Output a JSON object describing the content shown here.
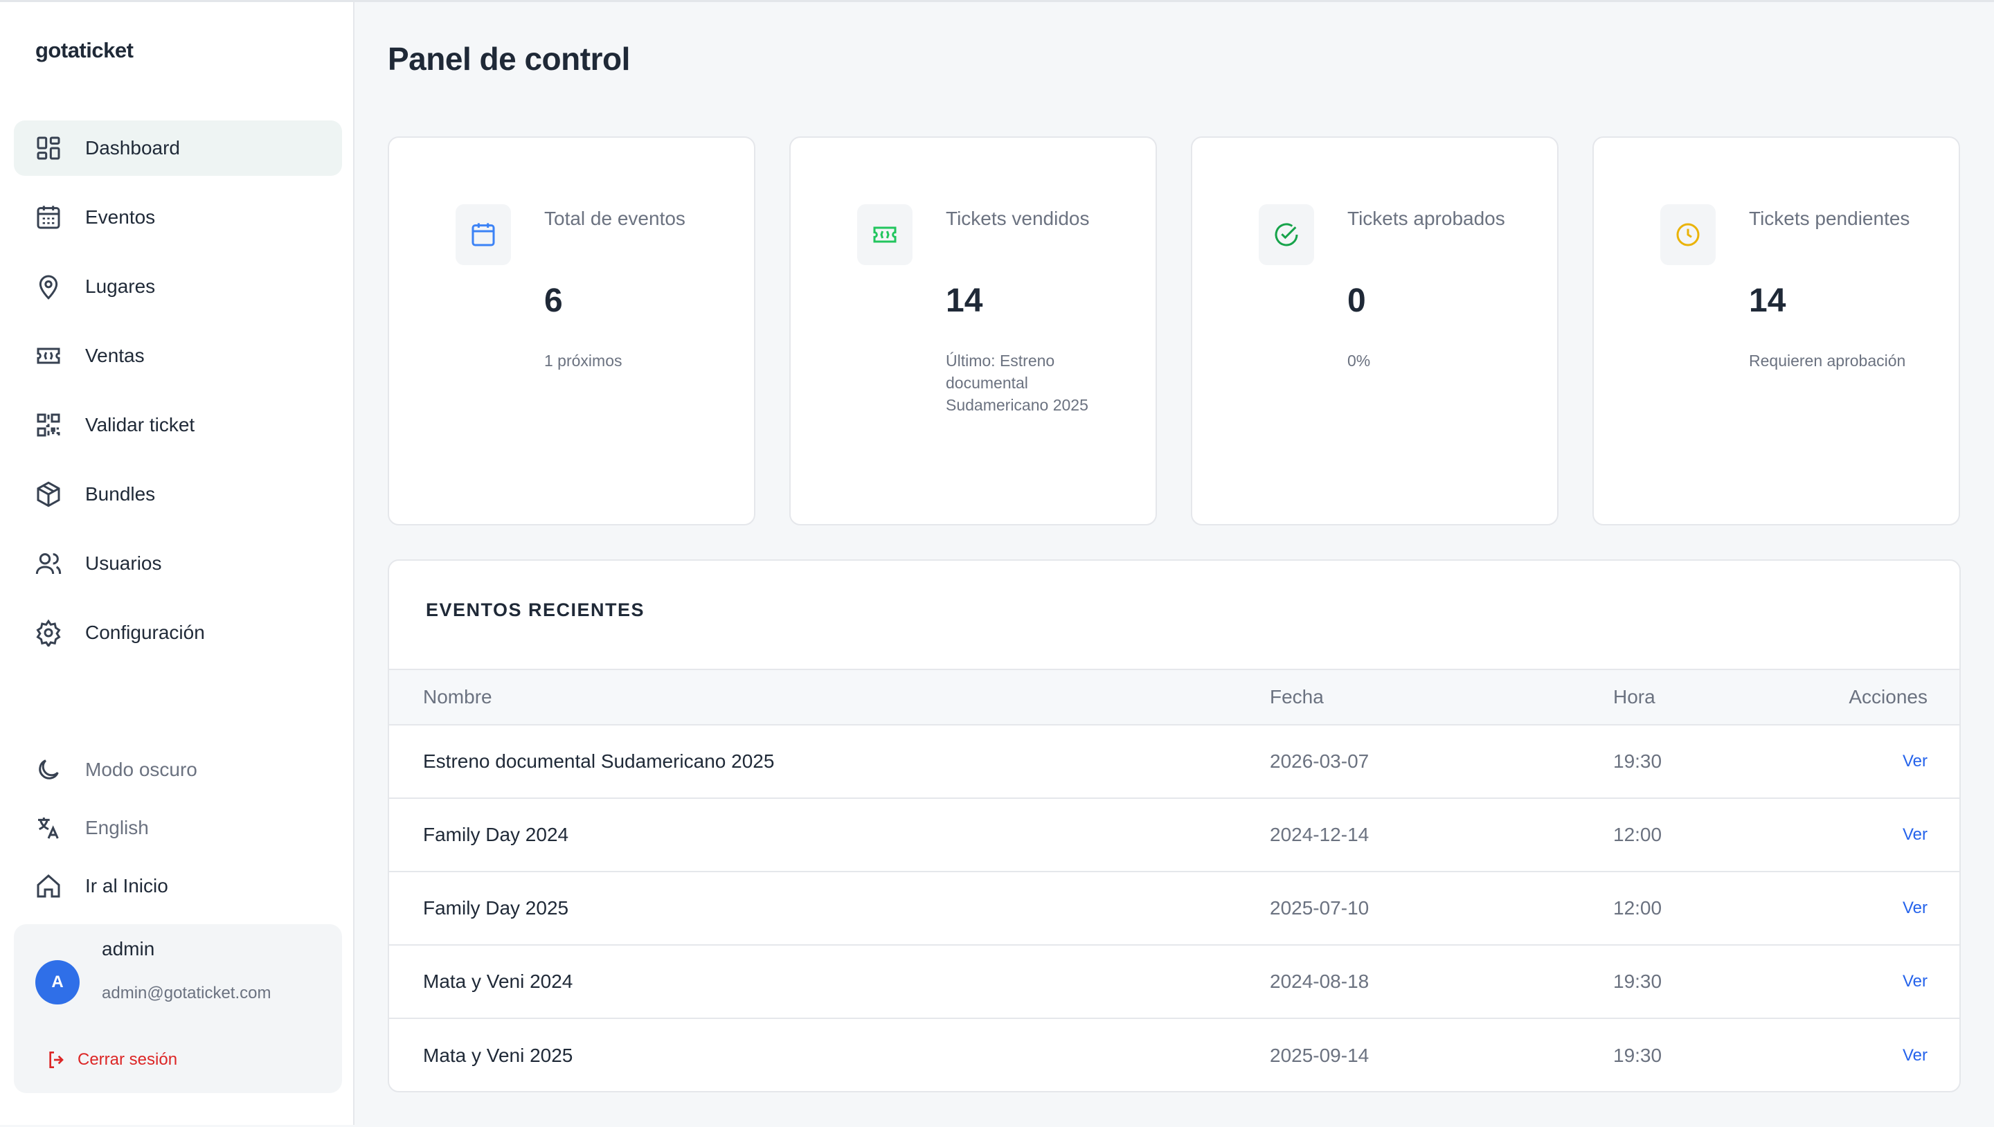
{
  "brand": "gotaticket",
  "nav": [
    {
      "label": "Dashboard",
      "icon": "dashboard-icon",
      "active": true
    },
    {
      "label": "Eventos",
      "icon": "calendar-icon"
    },
    {
      "label": "Lugares",
      "icon": "map-pin-icon"
    },
    {
      "label": "Ventas",
      "icon": "ticket-icon"
    },
    {
      "label": "Validar ticket",
      "icon": "qr-code-icon"
    },
    {
      "label": "Bundles",
      "icon": "package-icon"
    },
    {
      "label": "Usuarios",
      "icon": "users-icon"
    },
    {
      "label": "Configuración",
      "icon": "gear-icon"
    }
  ],
  "bottom": {
    "dark_mode": "Modo oscuro",
    "language": "English",
    "home": "Ir al Inicio"
  },
  "user": {
    "initial": "A",
    "name": "admin",
    "email": "admin@gotaticket.com",
    "logout": "Cerrar sesión"
  },
  "page_title": "Panel de control",
  "stats": [
    {
      "label": "Total de eventos",
      "value": "6",
      "sub": "1 próximos",
      "icon": "calendar-icon",
      "color": "#3b82f6"
    },
    {
      "label": "Tickets vendidos",
      "value": "14",
      "sub": "Último: Estreno documental Sudamericano 2025",
      "icon": "ticket-icon",
      "color": "#22c55e"
    },
    {
      "label": "Tickets aprobados",
      "value": "0",
      "sub": "0%",
      "icon": "check-circle-icon",
      "color": "#16a34a"
    },
    {
      "label": "Tickets pendientes",
      "value": "14",
      "sub": "Requieren aprobación",
      "icon": "clock-icon",
      "color": "#eab308"
    }
  ],
  "events": {
    "title": "EVENTOS RECIENTES",
    "headers": {
      "name": "Nombre",
      "date": "Fecha",
      "time": "Hora",
      "actions": "Acciones"
    },
    "rows": [
      {
        "name": "Estreno documental Sudamericano 2025",
        "date": "2026-03-07",
        "time": "19:30",
        "action": "Ver"
      },
      {
        "name": "Family Day 2024",
        "date": "2024-12-14",
        "time": "12:00",
        "action": "Ver"
      },
      {
        "name": "Family Day 2025",
        "date": "2025-07-10",
        "time": "12:00",
        "action": "Ver"
      },
      {
        "name": "Mata y Veni 2024",
        "date": "2024-08-18",
        "time": "19:30",
        "action": "Ver"
      },
      {
        "name": "Mata y Veni 2025",
        "date": "2025-09-14",
        "time": "19:30",
        "action": "Ver"
      }
    ]
  }
}
